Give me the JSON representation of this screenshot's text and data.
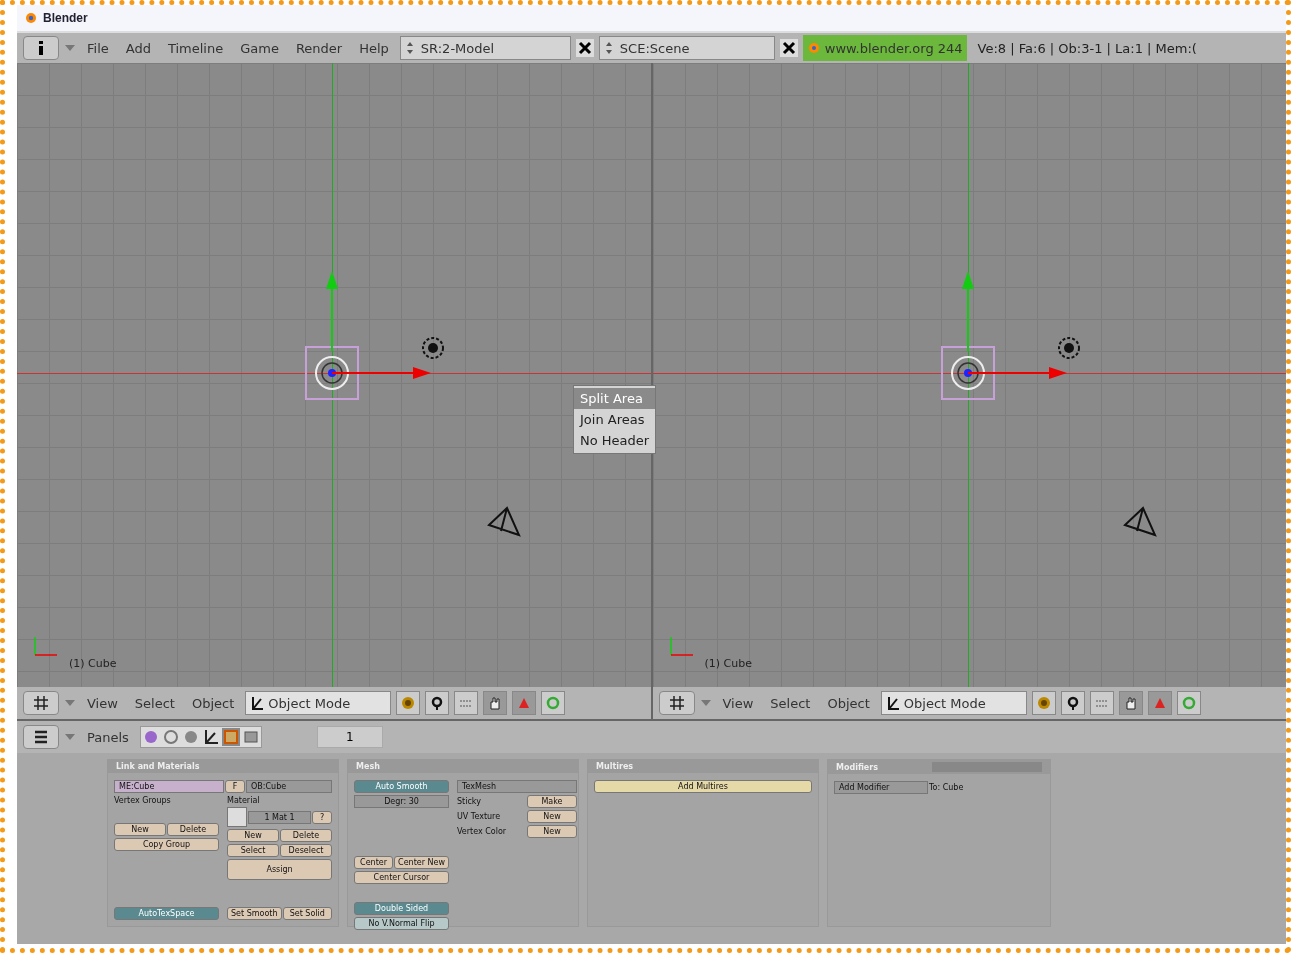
{
  "window": {
    "title": "Blender"
  },
  "top_header": {
    "menus": [
      "File",
      "Add",
      "Timeline",
      "Game",
      "Render",
      "Help"
    ],
    "screen": "SR:2-Model",
    "scene": "SCE:Scene",
    "version": "www.blender.org 244",
    "stats": "Ve:8 | Fa:6 | Ob:3-1 | La:1  | Mem:("
  },
  "viewports": [
    {
      "label": "(1) Cube",
      "menus": [
        "View",
        "Select",
        "Object"
      ],
      "mode": "Object Mode"
    },
    {
      "label": "(1) Cube",
      "menus": [
        "View",
        "Select",
        "Object"
      ],
      "mode": "Object Mode"
    }
  ],
  "context_menu": {
    "items": [
      {
        "label": "Split Area",
        "selected": true
      },
      {
        "label": "Join Areas",
        "selected": false
      },
      {
        "label": "No Header",
        "selected": false
      }
    ]
  },
  "buttons_header": {
    "label": "Panels",
    "frame": "1"
  },
  "link_panel": {
    "title": "Link and Materials",
    "mesh": "ME:Cube",
    "fake": "F",
    "object": "OB:Cube",
    "vgroups_label": "Vertex Groups",
    "material_label": "Material",
    "material": "1 Mat 1",
    "material_help": "?",
    "vgroup_buttons": [
      "New",
      "Delete"
    ],
    "copy_group": "Copy Group",
    "material_buttons": [
      "New",
      "Delete",
      "Select",
      "Deselect"
    ],
    "assign": "Assign",
    "autotex": {
      "label": "AutoTexSpace",
      "on": true
    },
    "shading": [
      "Set Smooth",
      "Set Solid"
    ]
  },
  "mesh_panel": {
    "title": "Mesh",
    "auto_smooth": {
      "label": "Auto Smooth",
      "on": true
    },
    "degr": "Degr: 30",
    "texmesh": "TexMesh",
    "extras": [
      {
        "label": "Sticky",
        "button": "Make"
      },
      {
        "label": "UV Texture",
        "button": "New"
      },
      {
        "label": "Vertex Color",
        "button": "New"
      }
    ],
    "center": [
      "Center",
      "Center New"
    ],
    "center_cursor": "Center Cursor",
    "toggles": [
      {
        "label": "Double Sided",
        "on": true
      },
      {
        "label": "No V.Normal Flip",
        "on": false
      }
    ]
  },
  "multires_panel": {
    "title": "Multires",
    "button": "Add Multires"
  },
  "modifiers_panel": {
    "title": "Modifiers",
    "add": "Add Modifier",
    "target": "To: Cube"
  }
}
